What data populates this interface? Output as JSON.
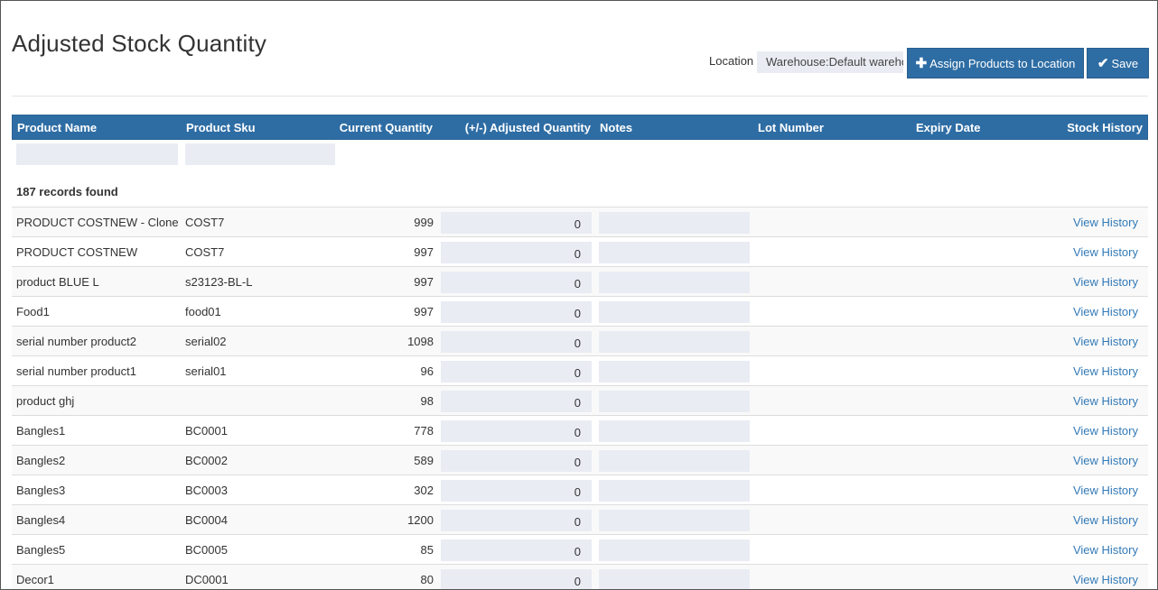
{
  "page": {
    "title": "Adjusted Stock Quantity"
  },
  "location": {
    "label": "Location",
    "value": "Warehouse:Default warehouse"
  },
  "buttons": {
    "assign_label": "Assign Products to Location",
    "save_label": "Save"
  },
  "table": {
    "headers": {
      "name": "Product Name",
      "sku": "Product Sku",
      "current": "Current Quantity",
      "adjusted": "(+/-) Adjusted Quantity",
      "notes": "Notes",
      "lot": "Lot Number",
      "expiry": "Expiry Date",
      "history": "Stock History"
    },
    "records_found": "187 records found",
    "rows": [
      {
        "name": "PRODUCT COSTNEW - Clone",
        "sku": "COST7",
        "current": "999",
        "adjusted": "0",
        "history": "View History"
      },
      {
        "name": "PRODUCT COSTNEW",
        "sku": "COST7",
        "current": "997",
        "adjusted": "0",
        "history": "View History"
      },
      {
        "name": "product BLUE L",
        "sku": "s23123-BL-L",
        "current": "997",
        "adjusted": "0",
        "history": "View History"
      },
      {
        "name": "Food1",
        "sku": "food01",
        "current": "997",
        "adjusted": "0",
        "history": "View History"
      },
      {
        "name": "serial number product2",
        "sku": "serial02",
        "current": "1098",
        "adjusted": "0",
        "history": "View History"
      },
      {
        "name": "serial number product1",
        "sku": "serial01",
        "current": "96",
        "adjusted": "0",
        "history": "View History"
      },
      {
        "name": "product ghj",
        "sku": "",
        "current": "98",
        "adjusted": "0",
        "history": "View History"
      },
      {
        "name": "Bangles1",
        "sku": "BC0001",
        "current": "778",
        "adjusted": "0",
        "history": "View History"
      },
      {
        "name": "Bangles2",
        "sku": "BC0002",
        "current": "589",
        "adjusted": "0",
        "history": "View History"
      },
      {
        "name": "Bangles3",
        "sku": "BC0003",
        "current": "302",
        "adjusted": "0",
        "history": "View History"
      },
      {
        "name": "Bangles4",
        "sku": "BC0004",
        "current": "1200",
        "adjusted": "0",
        "history": "View History"
      },
      {
        "name": "Bangles5",
        "sku": "BC0005",
        "current": "85",
        "adjusted": "0",
        "history": "View History"
      },
      {
        "name": "Decor1",
        "sku": "DC0001",
        "current": "80",
        "adjusted": "0",
        "history": "View History"
      }
    ]
  }
}
